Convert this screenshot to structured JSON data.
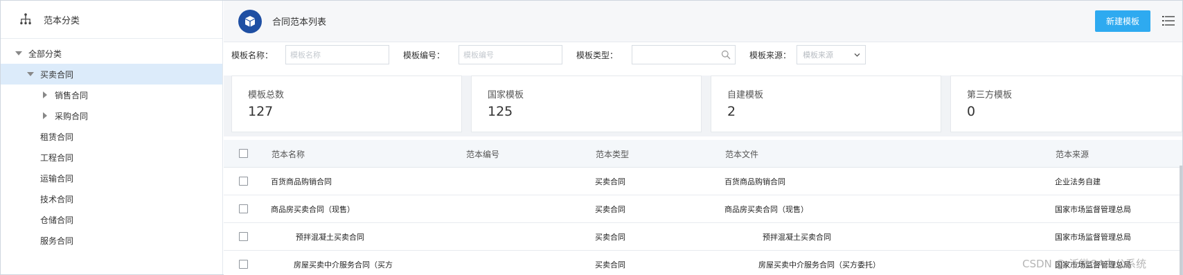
{
  "sidebar": {
    "title": "范本分类",
    "tree": [
      {
        "label": "全部分类",
        "caret": "down",
        "level": 0,
        "selected": false
      },
      {
        "label": "买卖合同",
        "caret": "down",
        "level": 1,
        "selected": true
      },
      {
        "label": "销售合同",
        "caret": "right",
        "level": 2,
        "selected": false
      },
      {
        "label": "采购合同",
        "caret": "right",
        "level": 2,
        "selected": false
      },
      {
        "label": "租赁合同",
        "caret": "none",
        "level": 1,
        "selected": false
      },
      {
        "label": "工程合同",
        "caret": "none",
        "level": 1,
        "selected": false
      },
      {
        "label": "运输合同",
        "caret": "none",
        "level": 1,
        "selected": false
      },
      {
        "label": "技术合同",
        "caret": "none",
        "level": 1,
        "selected": false
      },
      {
        "label": "仓储合同",
        "caret": "none",
        "level": 1,
        "selected": false
      },
      {
        "label": "服务合同",
        "caret": "none",
        "level": 1,
        "selected": false
      }
    ]
  },
  "header": {
    "page_title": "合同范本列表",
    "new_button": "新建模板"
  },
  "filters": {
    "name_label": "模板名称：",
    "name_placeholder": "模板名称",
    "code_label": "模板编号：",
    "code_placeholder": "模板编号",
    "type_label": "模板类型：",
    "source_label": "模板来源：",
    "source_placeholder": "模板来源"
  },
  "stats": [
    {
      "label": "模板总数",
      "value": "127"
    },
    {
      "label": "国家模板",
      "value": "125"
    },
    {
      "label": "自建模板",
      "value": "2"
    },
    {
      "label": "第三方模板",
      "value": "0"
    }
  ],
  "table": {
    "columns": [
      "范本名称",
      "范本编号",
      "范本类型",
      "范本文件",
      "范本来源"
    ],
    "rows": [
      {
        "name": "百货商品购销合同",
        "code": "",
        "type": "买卖合同",
        "file": "百货商品购销合同",
        "source": "企业法务自建"
      },
      {
        "name": "商品房买卖合同（现售）",
        "code": "",
        "type": "买卖合同",
        "file": "商品房买卖合同（现售）",
        "source": "国家市场监督管理总局"
      },
      {
        "name": "预拌混凝土买卖合同",
        "code": "",
        "type": "买卖合同",
        "file": "预拌混凝土买卖合同",
        "source": "国家市场监督管理总局"
      },
      {
        "name": "房屋买卖中介服务合同（买方",
        "code": "",
        "type": "买卖合同",
        "file": "房屋买卖中介服务合同（买方委托）",
        "source": "国家市场监督管理总局"
      }
    ]
  },
  "watermark": "CSDN @ 泛微OA办公系统",
  "colors": {
    "accent": "#2eaaf0",
    "logo": "#1f4fa3",
    "selected_row": "#dcebfa"
  }
}
